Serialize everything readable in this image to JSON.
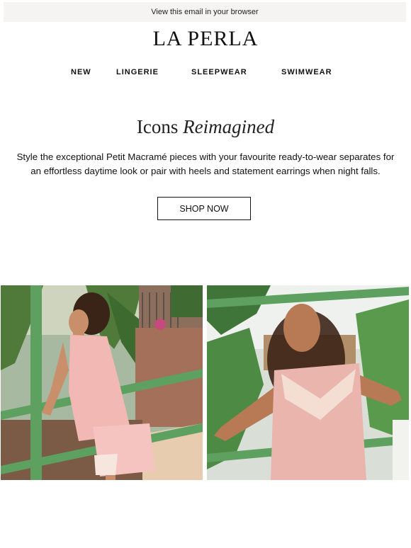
{
  "header": {
    "view_in_browser": "View this email in your browser",
    "logo_text": "LA PERLA"
  },
  "nav": {
    "items": [
      {
        "label": "NEW"
      },
      {
        "label": "LINGERIE"
      },
      {
        "label": "SLEEPWEAR"
      },
      {
        "label": "SWIMWEAR"
      }
    ]
  },
  "hero": {
    "headline_plain": "Icons ",
    "headline_italic": "Reimagined",
    "body": "Style the exceptional Petit Macramé pieces with your favourite ready-to-wear separates for an effortless daytime look or pair with heels and statement earrings when night falls.",
    "cta_label": "SHOP NOW"
  },
  "colors": {
    "topbar_bg": "#f5f4f2",
    "text": "#111111",
    "rail_green": "#5ea060",
    "silk_pink": "#f2b8b4"
  }
}
